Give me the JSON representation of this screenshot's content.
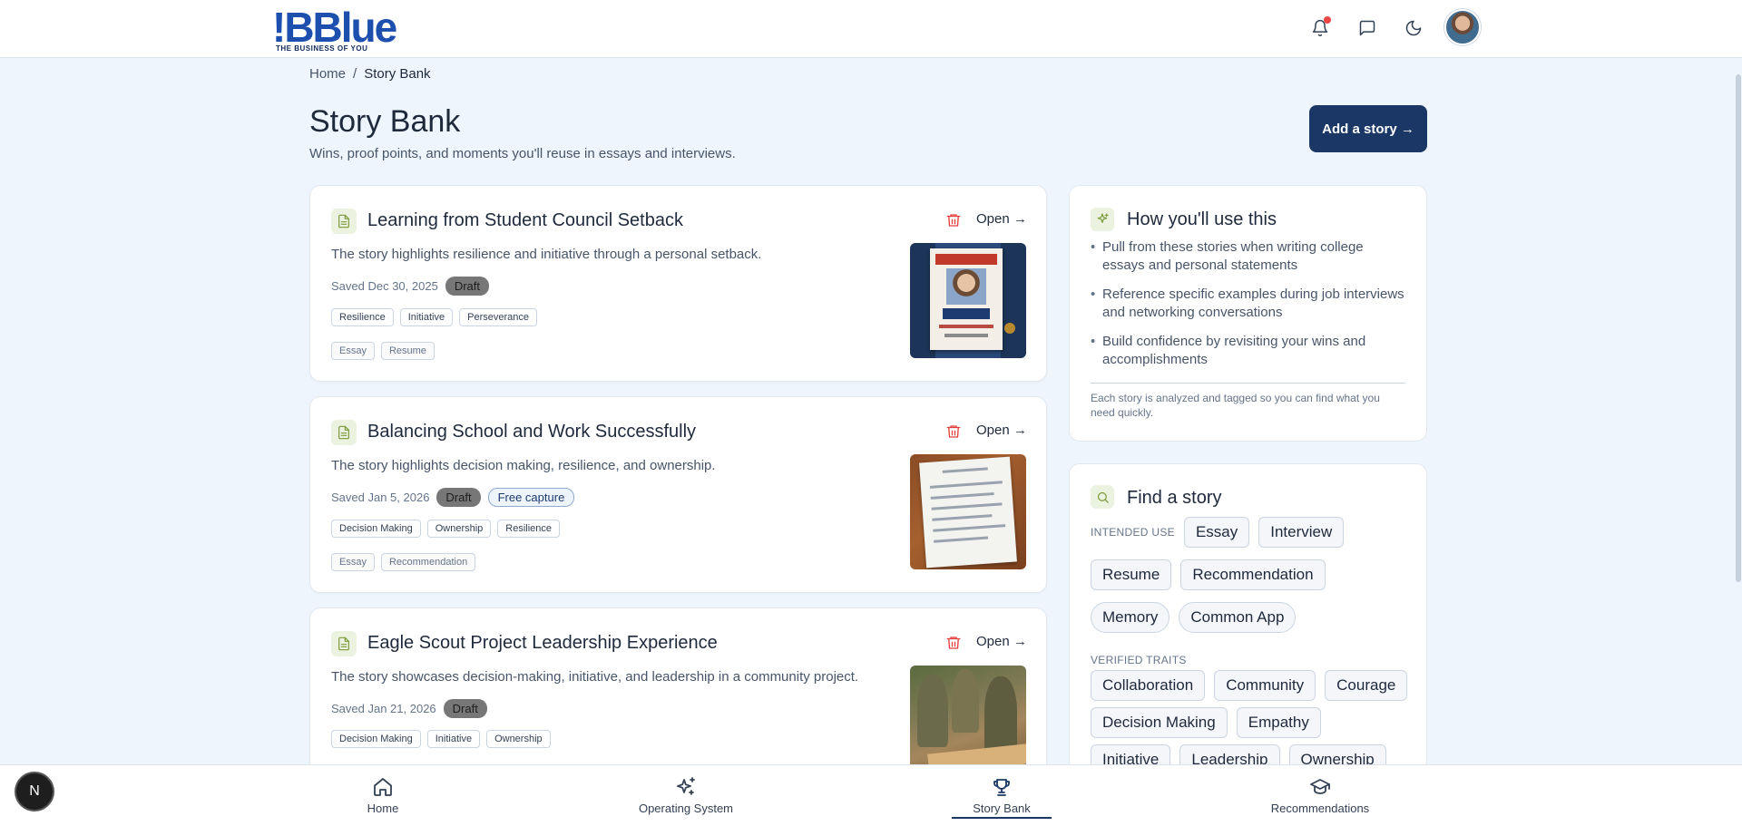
{
  "brand": {
    "name": "Blue",
    "mark": "!B",
    "tagline": "THE BUSINESS OF YOU"
  },
  "topbar": {
    "icons": [
      "bell-icon",
      "chat-icon",
      "moon-icon"
    ],
    "notification_dot": true
  },
  "breadcrumb": {
    "home": "Home",
    "separator": "/",
    "current": "Story Bank"
  },
  "header": {
    "title": "Story Bank",
    "subtitle": "Wins, proof points, and moments you'll reuse in essays and interviews.",
    "add_label": "Add a story →"
  },
  "stories": [
    {
      "title": "Learning from Student Council Setback",
      "open_label": "Open →",
      "summary": "The story highlights resilience and initiative through a personal setback.",
      "saved": "Saved Dec 30, 2025",
      "status": "Draft",
      "traits": [
        "Resilience",
        "Initiative",
        "Perseverance"
      ],
      "uses": [
        "Essay",
        "Resume"
      ]
    },
    {
      "title": "Balancing School and Work Successfully",
      "open_label": "Open →",
      "summary": "The story highlights decision making, resilience, and ownership.",
      "saved": "Saved Jan 5, 2026",
      "status": "Draft",
      "capture": "Free capture",
      "traits": [
        "Decision Making",
        "Ownership",
        "Resilience"
      ],
      "uses": [
        "Essay",
        "Recommendation"
      ]
    },
    {
      "title": "Eagle Scout Project Leadership Experience",
      "open_label": "Open →",
      "summary": "The story showcases decision-making, initiative, and leadership in a community project.",
      "saved": "Saved Jan 21, 2026",
      "status": "Draft",
      "traits": [
        "Decision Making",
        "Initiative",
        "Ownership"
      ]
    }
  ],
  "how_to_use": {
    "title": "How you'll use this",
    "items": [
      "Pull from these stories when writing college essays and personal statements",
      "Reference specific examples during job interviews and networking conversations",
      "Build confidence by revisiting your wins and accomplishments"
    ],
    "note": "Each story is analyzed and tagged so you can find what you need quickly."
  },
  "find_story": {
    "title": "Find a story",
    "intended_use_label": "INTENDED USE",
    "intended_use": [
      "Essay",
      "Interview",
      "Resume",
      "Recommendation",
      "Memory",
      "Common App"
    ],
    "verified_traits_label": "VERIFIED TRAITS",
    "verified_traits": [
      "Collaboration",
      "Community",
      "Courage",
      "Decision Making",
      "Empathy",
      "Initiative",
      "Leadership",
      "Ownership"
    ]
  },
  "bottom_nav": {
    "items": [
      {
        "label": "Home",
        "icon": "home-icon"
      },
      {
        "label": "Operating System",
        "icon": "sparkles-icon"
      },
      {
        "label": "Story Bank",
        "icon": "trophy-icon",
        "active": true
      },
      {
        "label": "Recommendations",
        "icon": "graduation-cap-icon"
      }
    ]
  },
  "fab": {
    "label": "N"
  },
  "colors": {
    "primary": "#1b3766",
    "brand_blue": "#1d4fae",
    "danger": "#e53e3e",
    "icon_bg": "#ecf2e0",
    "page_bg": "#eef5fc"
  }
}
